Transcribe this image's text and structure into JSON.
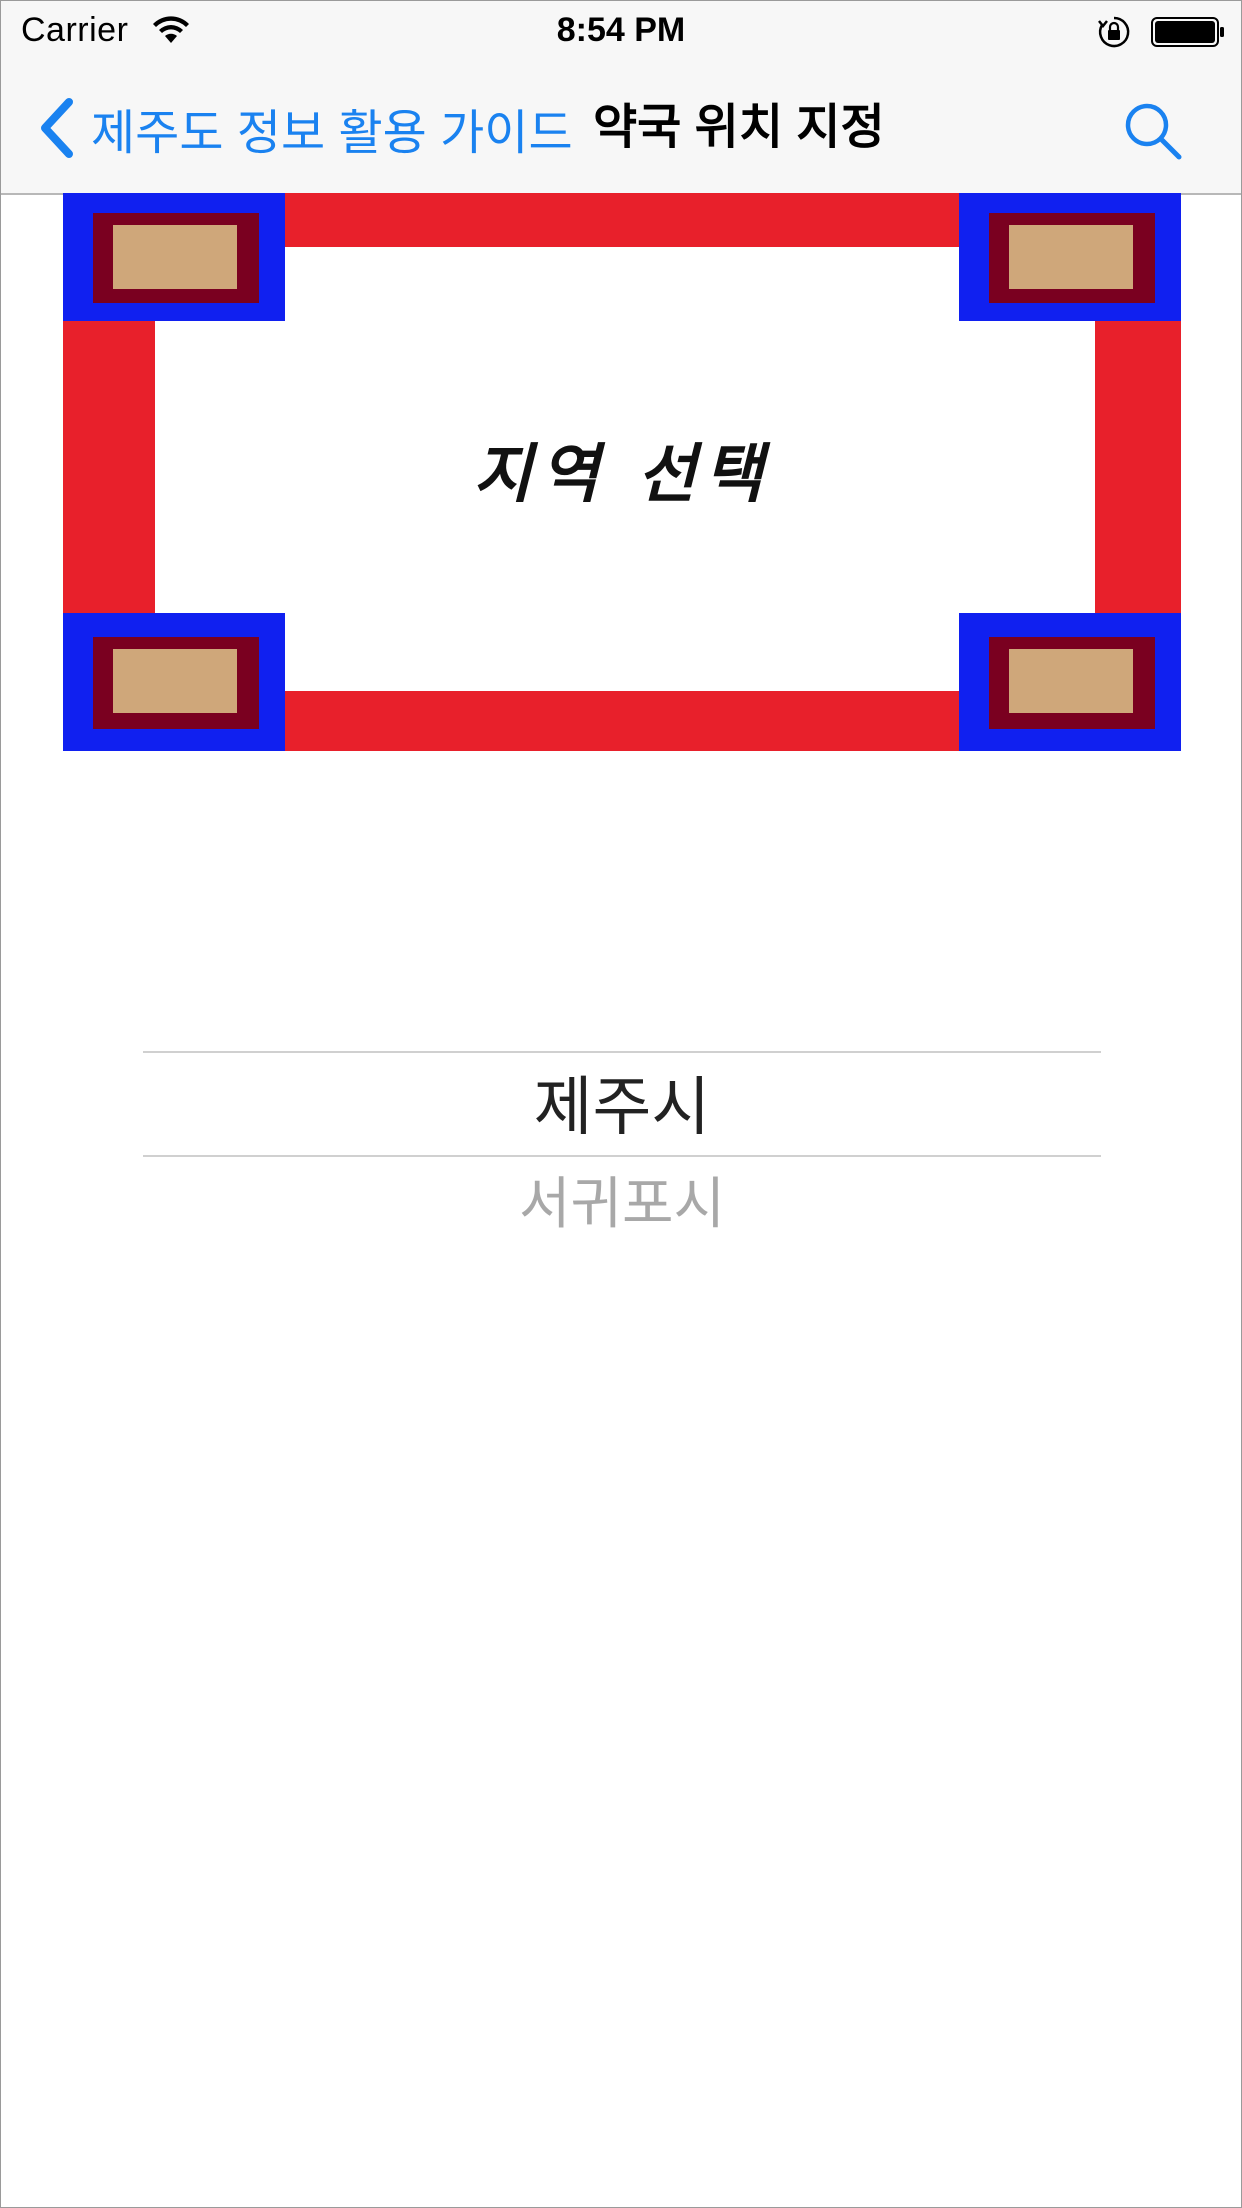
{
  "status_bar": {
    "carrier": "Carrier",
    "time": "8:54 PM",
    "icons": [
      "wifi-icon",
      "orientation-lock-icon",
      "battery-icon"
    ]
  },
  "nav_bar": {
    "back_label": "제주도 정보 활용 가이드",
    "title": "약국 위치 지정",
    "back_icon": "chevron-left-icon",
    "search_icon": "search-icon"
  },
  "banner": {
    "text": "지역 선택"
  },
  "picker": {
    "selected": "제주시",
    "options": [
      "제주시",
      "서귀포시"
    ],
    "next": "서귀포시"
  },
  "colors": {
    "accent": "#1a82f0",
    "banner_red": "#e8202b",
    "banner_blue": "#1020f0",
    "banner_maroon": "#7a0020",
    "banner_tan": "#cfa77a"
  }
}
